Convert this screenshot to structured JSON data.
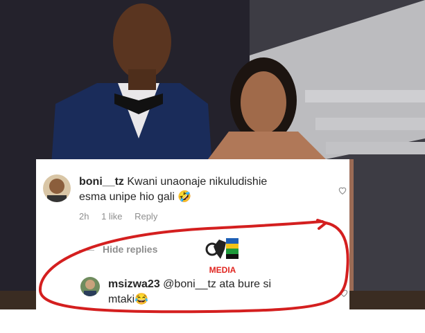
{
  "comment": {
    "username": "boni__tz",
    "text_line1": "Kwani unaonaje nikuludishie",
    "text_line2": "esma  unipe hio gali",
    "emoji": "🤣",
    "time": "2h",
    "likes": "1 like",
    "reply_label": "Reply"
  },
  "replies_toggle": {
    "label": "Hide replies"
  },
  "reply": {
    "username": "msizwa23",
    "text_line1": "@boni__tz ata bure si",
    "text_line2": "mtaki",
    "emoji": "😂"
  },
  "watermark": {
    "text": "MEDIA"
  },
  "colors": {
    "annotation_circle": "#d41f1f",
    "watermark_text": "#e0241f"
  }
}
